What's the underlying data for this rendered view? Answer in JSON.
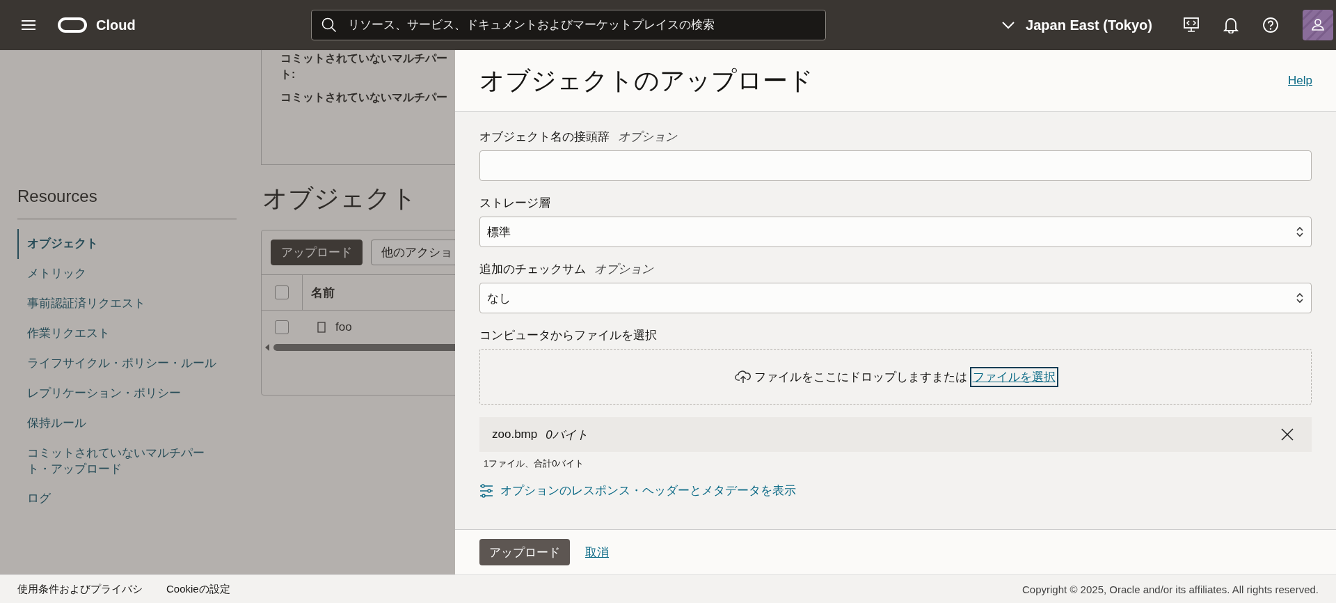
{
  "header": {
    "brand": "Cloud",
    "search": {
      "placeholder": "リソース、サービス、ドキュメントおよびマーケットプレイスの検索"
    },
    "region": "Japan East (Tokyo)"
  },
  "page": {
    "details": [
      {
        "text": "コミットされていないマルチパート:"
      },
      {
        "text": "コミットされていないマルチパー"
      }
    ],
    "resources": {
      "title": "Resources",
      "items": [
        {
          "label": "オブジェクト",
          "selected": true
        },
        {
          "label": "メトリック",
          "selected": false
        },
        {
          "label": "事前認証済リクエスト",
          "selected": false
        },
        {
          "label": "作業リクエスト",
          "selected": false
        },
        {
          "label": "ライフサイクル・ポリシー・ルール",
          "selected": false
        },
        {
          "label": "レプリケーション・ポリシー",
          "selected": false
        },
        {
          "label": "保持ルール",
          "selected": false
        },
        {
          "label": "コミットされていないマルチパート・アップロード",
          "selected": false
        },
        {
          "label": "ログ",
          "selected": false
        }
      ]
    },
    "objects": {
      "title": "オブジェクト",
      "buttons": [
        "アップロード",
        "他のアクショ"
      ],
      "columns": [
        "名前"
      ],
      "header_checked": false,
      "rows": [
        {
          "name": "foo",
          "checked": false
        }
      ]
    }
  },
  "drawer": {
    "title": "オブジェクトのアップロード",
    "help": "Help",
    "prefix": {
      "label": "オブジェクト名の接頭辞",
      "optional": "オプション"
    },
    "tier": {
      "label": "ストレージ層",
      "value": "標準"
    },
    "checksum": {
      "label": "追加のチェックサム",
      "optional": "オプション",
      "value": "なし"
    },
    "file": {
      "label": "コンピュータからファイルを選択",
      "drop_text": "ファイルをここにドロップしますまたは",
      "choose": "ファイルを選択"
    },
    "files": [
      {
        "name": "zoo.bmp",
        "size": "0バイト"
      }
    ],
    "summary": "1ファイル、合計0バイト",
    "options_link": "オプションのレスポンス・ヘッダーとメタデータを表示",
    "buttons": {
      "primary": "アップロード",
      "cancel": "取消"
    }
  },
  "footer": {
    "links": [
      "使用条件およびプライバシ",
      "Cookieの設定"
    ],
    "copyright": "Copyright © 2025, Oracle and/or its affiliates. All rights reserved."
  }
}
